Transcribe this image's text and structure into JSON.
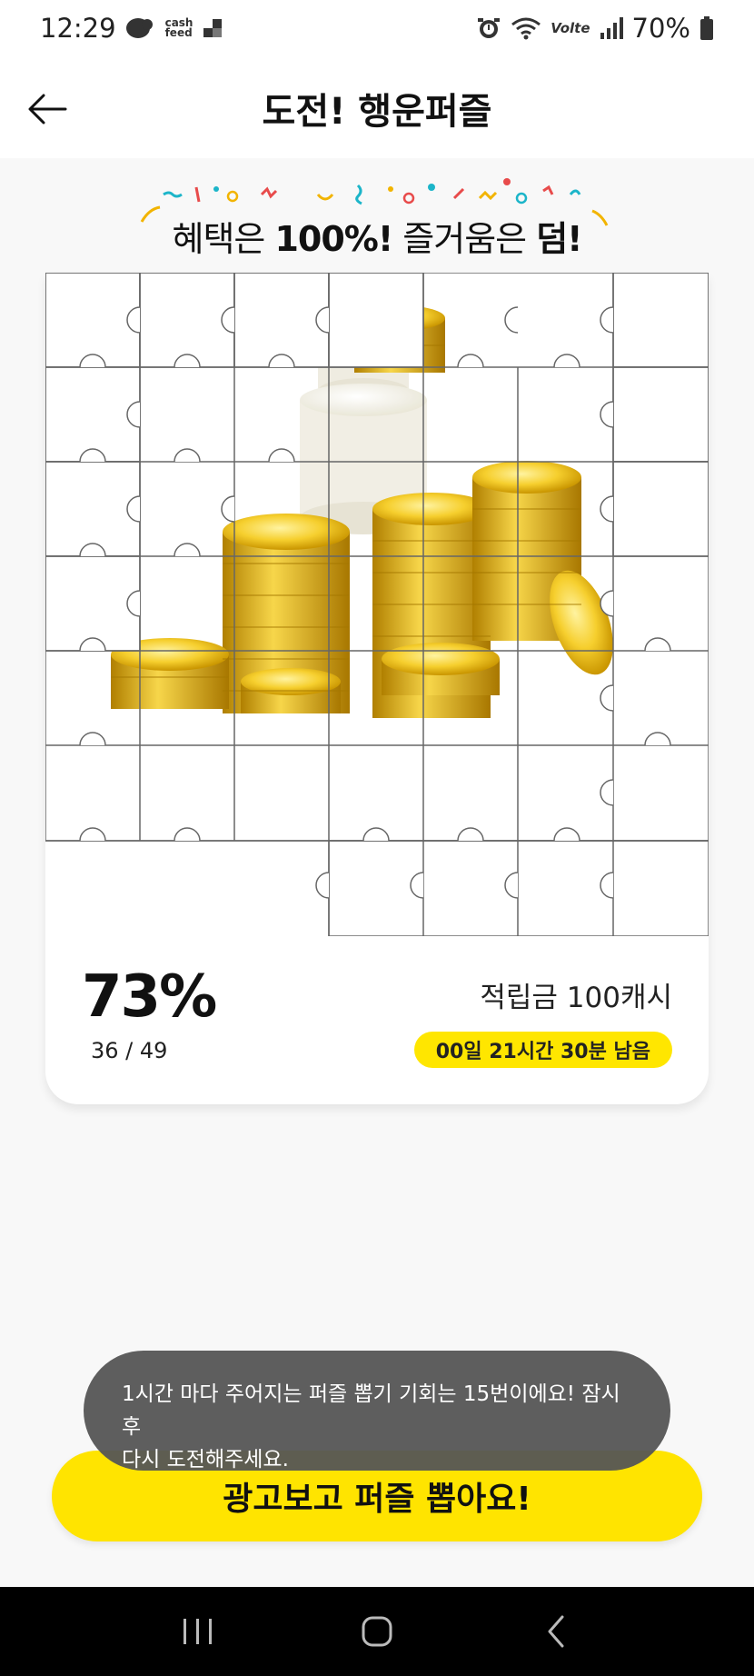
{
  "status_bar": {
    "time": "12:29",
    "app_icon_label": "cash\nfeed",
    "network_label": "Volte",
    "battery": "70%",
    "icons": [
      "cashfeed-icon",
      "notification-icon",
      "alarm-icon",
      "wifi-icon",
      "volte-icon",
      "signal-icon",
      "battery-icon"
    ]
  },
  "header": {
    "title": "도전! 행운퍼즐",
    "back_icon": "arrow-left-icon"
  },
  "banner": {
    "pre": "혜택은 ",
    "bold1": "100%!",
    "mid": " 즐거움은 ",
    "bold2": "덤!"
  },
  "puzzle": {
    "rows": 7,
    "cols": 7,
    "image": "gold-coins-stack",
    "revealed_pieces": 36,
    "total_pieces": 49
  },
  "progress": {
    "percent": "73%",
    "count": "36 / 49",
    "fraction": 0.73
  },
  "reward": {
    "label": "적립금 100캐시"
  },
  "timer": {
    "label": "00일 21시간 30분 남음"
  },
  "cta": {
    "label": "광고보고 퍼즐 뽑아요!"
  },
  "toast": {
    "line1": "1시간 마다 주어지는 퍼즐 뽑기 기회는 15번이에요! 잠시 후",
    "line2": "다시 도전해주세요."
  },
  "nav": {
    "items": [
      "recent-apps-icon",
      "home-icon",
      "back-icon"
    ]
  },
  "colors": {
    "accent_yellow": "#ffe400",
    "toast_bg": "#555555",
    "nav_bg": "#000000",
    "coin_gold": "#f2c21b"
  }
}
